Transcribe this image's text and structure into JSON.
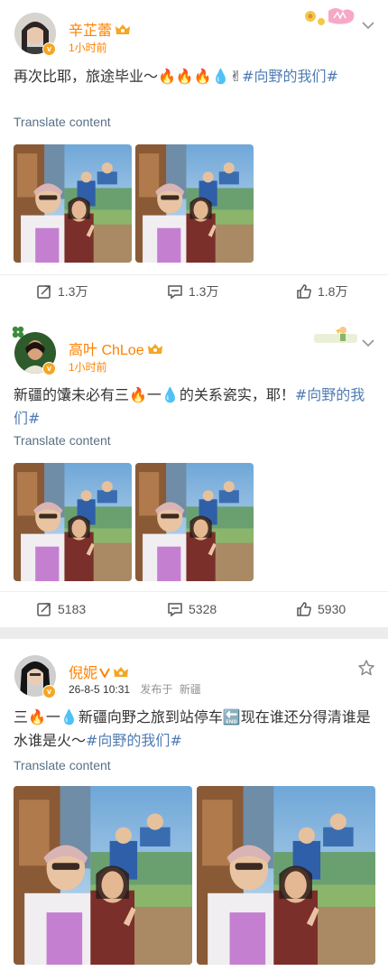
{
  "posts": [
    {
      "username": "辛芷蕾",
      "time": "1小时前",
      "text_before": "再次比耶，旅途毕业～🔥🔥🔥💧✌",
      "hashtag": "#向野的我们#",
      "translate": "Translate content",
      "repost": "1.3万",
      "comment": "1.3万",
      "like": "1.8万"
    },
    {
      "username": "高叶 ChLoe",
      "time": "1小时前",
      "text_before": "新疆的馕未必有三🔥一💧的关系瓷实，耶！",
      "hashtag": "#向野的我们#",
      "translate": "Translate content",
      "repost": "5183",
      "comment": "5328",
      "like": "5930"
    },
    {
      "username": "倪妮",
      "time": "26-8-5 10:31",
      "location_prefix": "发布于",
      "location": "新疆",
      "text_before": "三🔥一💧新疆向野之旅到站停车🔚现在谁还分得清谁是水谁是火～",
      "hashtag": "#向野的我们#",
      "translate": "Translate content"
    }
  ],
  "icons": {
    "repost": "repost-icon",
    "comment": "comment-icon",
    "like": "like-icon",
    "more": "chevron-down-icon",
    "star": "star-icon",
    "verified": "verified-v-icon",
    "crown": "crown-badge-icon"
  },
  "colors": {
    "username": "#ff8200",
    "hashtag": "#4f7bb3",
    "translate": "#5a6f86"
  }
}
